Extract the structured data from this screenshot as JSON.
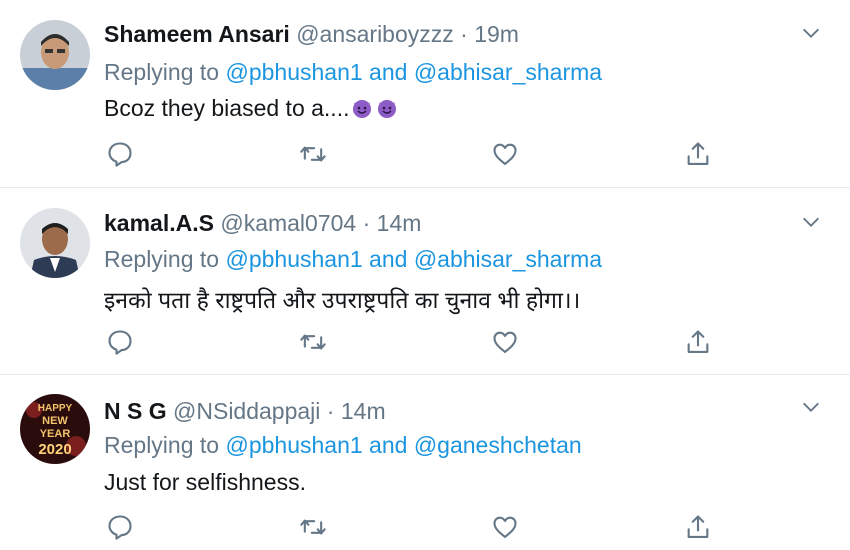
{
  "tweets": [
    {
      "name": "Shameem Ansari",
      "handle": "@ansariboyzzz",
      "separator": "·",
      "time": "19m",
      "replying_prefix": "Replying to",
      "mention_1": "@pbhushan1",
      "and": "and",
      "mention_2": "@abhisar_sharma",
      "text": "Bcoz they biased to a....",
      "emoji": "smiling-devil-emoji"
    },
    {
      "name": "kamal.A.S",
      "handle": "@kamal0704",
      "separator": "·",
      "time": "14m",
      "replying_prefix": "Replying to",
      "mention_1": "@pbhushan1",
      "and": "and",
      "mention_2": "@abhisar_sharma",
      "text": "इनको पता है राष्ट्रपति और उपराष्ट्रपति का चुनाव भी होगा।।"
    },
    {
      "name": "N S G",
      "handle": "@NSiddappaji",
      "separator": "·",
      "time": "14m",
      "replying_prefix": "Replying to",
      "mention_1": "@pbhushan1",
      "and": "and",
      "mention_2": "@ganeshchetan",
      "text": "Just for selfishness.",
      "avatar_text": [
        "HAPPY",
        "NEW",
        "YEAR",
        "2020"
      ]
    }
  ],
  "colors": {
    "name": "#14171a",
    "meta": "#657786",
    "link": "#1b95e0",
    "divider": "#e6ecf0"
  },
  "icons": [
    "reply-icon",
    "retweet-icon",
    "like-icon",
    "share-icon",
    "chevron-down-icon"
  ]
}
